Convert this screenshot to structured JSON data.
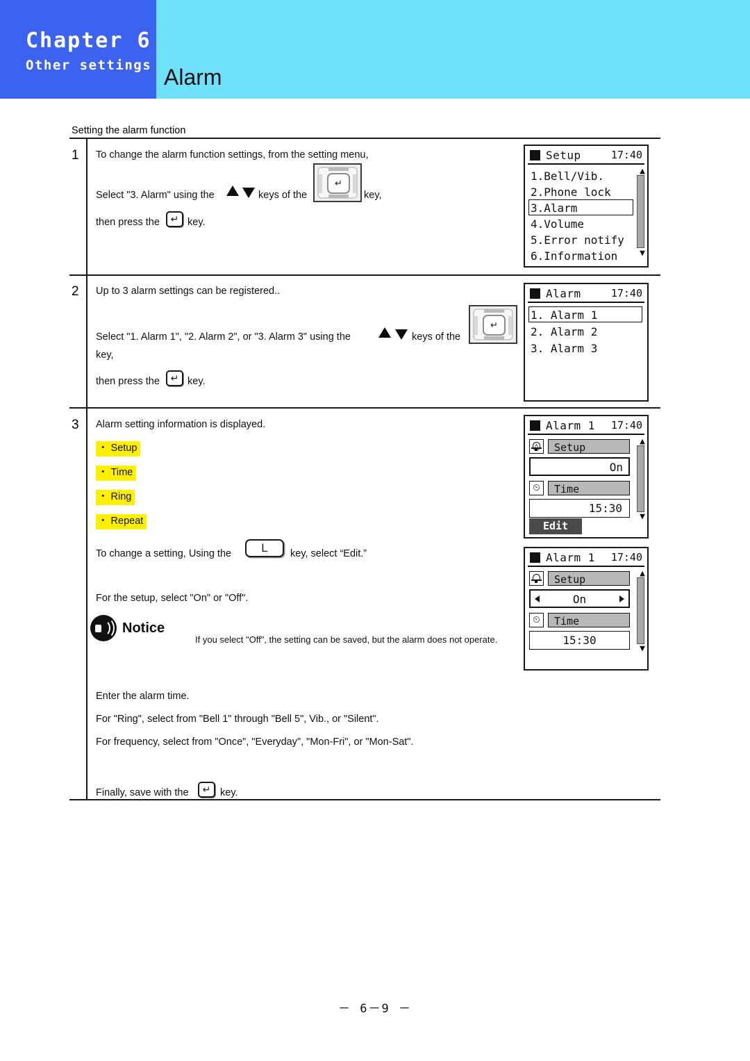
{
  "header": {
    "chapter": "Chapter 6",
    "chapter_sub": "Other settings",
    "page_heading": "Alarm",
    "accent_blue": "#3b63f0",
    "accent_cyan": "#6fe1fb"
  },
  "section": {
    "label": "Setting the alarm function"
  },
  "steps": [
    {
      "number": "1",
      "lines": [
        "To change the alarm function settings, from the setting menu,",
        "Select \"3. Alarm\" using the",
        "keys of the",
        "key,",
        "then press the",
        "key."
      ]
    },
    {
      "number": "2",
      "lines": [
        "Up to 3 alarm settings can be registered..",
        "Select \"1. Alarm 1\", \"2. Alarm 2\", or \"3. Alarm 3\" using the",
        "keys of the",
        "key,",
        "then press the",
        "key."
      ]
    },
    {
      "number": "3",
      "lines": [
        "Alarm setting information is displayed.",
        "To change a setting, Using the",
        "key, select “Edit.”",
        "For the setup, select \"On\" or \"Off\".",
        "Enter the alarm time.",
        "For \"Ring\", select from \"Bell 1\" through \"Bell 5\", Vib., or \"Silent\".",
        "For frequency, select from \"Once\", \"Everyday\", \"Mon-Fri\", or \"Mon-Sat\".",
        "Finally, save with the",
        "key."
      ],
      "highlights": [
        "・ Setup",
        "・ Time",
        "・ Ring",
        "・ Repeat"
      ],
      "highlight_color": "#ffef00"
    }
  ],
  "notice": {
    "title": "Notice",
    "body": "If you select \"Off\", the setting can be saved, but the alarm does not operate."
  },
  "screens": {
    "setup": {
      "title": "Setup",
      "time": "17:40",
      "items": [
        "1.Bell/Vib.",
        "2.Phone lock",
        "3.Alarm",
        "4.Volume",
        "5.Error notify",
        "6.Information"
      ],
      "selected_index": 2
    },
    "alarm_list": {
      "title": "Alarm",
      "time": "17:40",
      "items": [
        "1. Alarm 1",
        "2. Alarm 2",
        "3. Alarm 3"
      ],
      "selected_index": 0
    },
    "alarm_detail": {
      "title": "Alarm 1",
      "time": "17:40",
      "setup_label": "Setup",
      "setup_value": "On",
      "time_label": "Time",
      "time_value": "15:30",
      "softkey": "Edit"
    },
    "alarm_edit": {
      "title": "Alarm 1",
      "time": "17:40",
      "setup_label": "Setup",
      "setup_value": "On",
      "time_label": "Time",
      "time_value": "15:30"
    }
  },
  "footer": {
    "page": "－ 6－9 －"
  }
}
